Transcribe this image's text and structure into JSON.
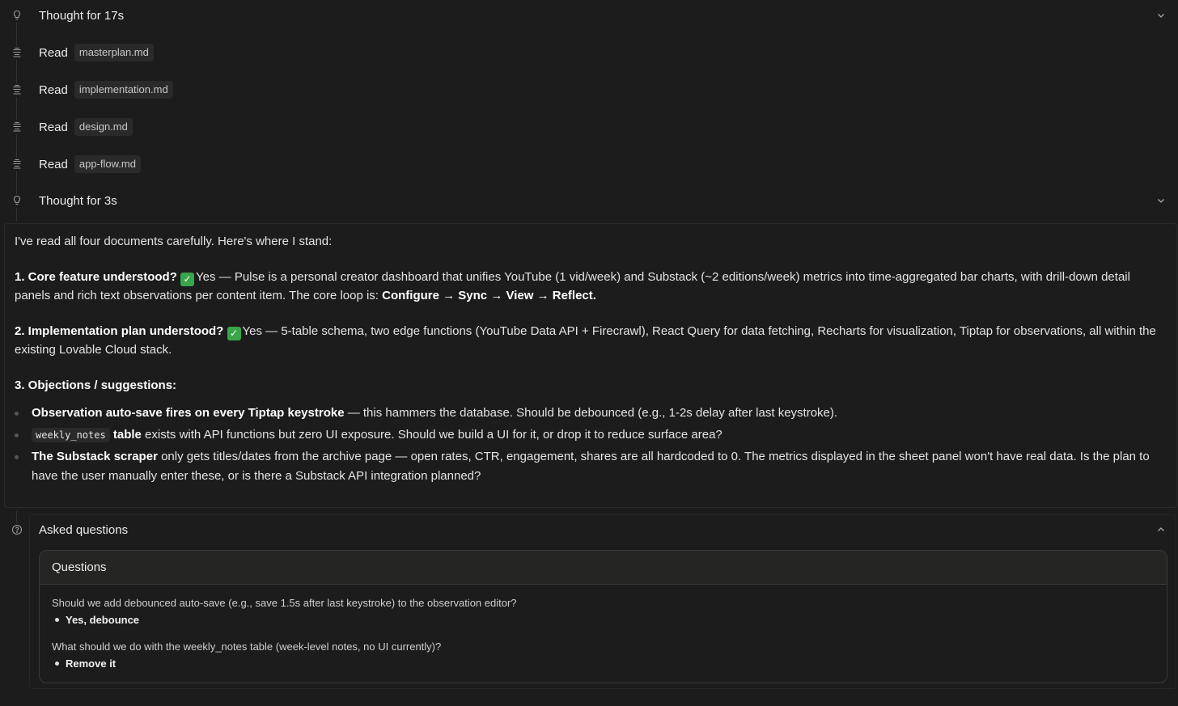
{
  "timeline": [
    {
      "type": "thought",
      "icon": "lightbulb-icon",
      "label": "Thought for 17s"
    },
    {
      "type": "read",
      "icon": "file-icon",
      "label": "Read",
      "file": "masterplan.md"
    },
    {
      "type": "read",
      "icon": "file-icon",
      "label": "Read",
      "file": "implementation.md"
    },
    {
      "type": "read",
      "icon": "file-icon",
      "label": "Read",
      "file": "design.md"
    },
    {
      "type": "read",
      "icon": "file-icon",
      "label": "Read",
      "file": "app-flow.md"
    },
    {
      "type": "thought",
      "icon": "lightbulb-icon",
      "label": "Thought for 3s"
    }
  ],
  "message": {
    "intro": "I've read all four documents carefully. Here's where I stand:",
    "p1_title": "1. Core feature understood?",
    "p1_text": "Yes — Pulse is a personal creator dashboard that unifies YouTube (1 vid/week) and Substack (~2 editions/week) metrics into time-aggregated bar charts, with drill-down detail panels and rich text observations per content item. The core loop is: ",
    "p1_loop": "Configure → Sync → View → Reflect.",
    "p2_title": "2. Implementation plan understood?",
    "p2_text": "Yes — 5-table schema, two edge functions (YouTube Data API + Firecrawl), React Query for data fetching, Recharts for visualization, Tiptap for observations, all within the existing Lovable Cloud stack.",
    "p3_title": "3. Objections / suggestions:",
    "bullet1_bold": "Observation auto-save fires on every Tiptap keystroke",
    "bullet1_text": " — this hammers the database. Should be debounced (e.g., 1-2s delay after last keystroke).",
    "bullet2_code": "weekly_notes",
    "bullet2_bold": "table",
    "bullet2_text": " exists with API functions but zero UI exposure. Should we build a UI for it, or drop it to reduce surface area?",
    "bullet3_bold": "The Substack scraper",
    "bullet3_text": " only gets titles/dates from the archive page — open rates, CTR, engagement, shares are all hardcoded to 0. The metrics displayed in the sheet panel won't have real data. Is the plan to have the user manually enter these, or is there a Substack API integration planned?"
  },
  "asked": {
    "icon": "question-circle-icon",
    "label": "Asked questions",
    "panel_title": "Questions",
    "questions": [
      {
        "q": "Should we add debounced auto-save (e.g., save 1.5s after last keystroke) to the observation editor?",
        "a": "Yes, debounce"
      },
      {
        "q": "What should we do with the weekly_notes table (week-level notes, no UI currently)?",
        "a": "Remove it"
      }
    ]
  }
}
